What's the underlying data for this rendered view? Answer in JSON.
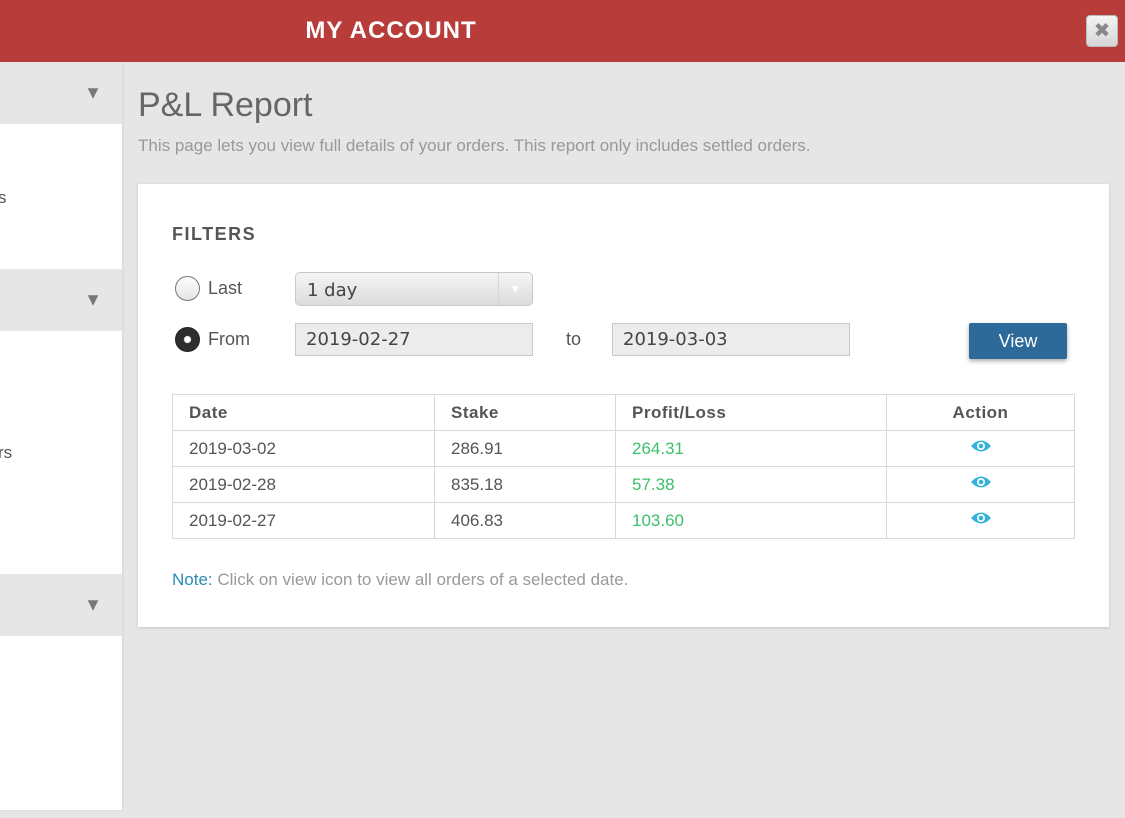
{
  "header": {
    "title": "MY ACCOUNT",
    "close_glyph": "✖"
  },
  "sidebar": {
    "arrow_glyph": "▼",
    "fragments": [
      "s",
      "rs"
    ]
  },
  "main": {
    "title": "P&L Report",
    "description": "This page lets you view full details of your orders. This report only includes settled orders."
  },
  "filters": {
    "heading": "FILTERS",
    "last_label": "Last",
    "last_selected": false,
    "period_value": "1 day",
    "from_label": "From",
    "from_selected": true,
    "from_date": "2019-02-27",
    "to_label": "to",
    "to_date": "2019-03-03",
    "view_button": "View"
  },
  "table": {
    "headers": {
      "date": "Date",
      "stake": "Stake",
      "pl": "Profit/Loss",
      "action": "Action"
    },
    "rows": [
      {
        "date": "2019-03-02",
        "stake": "286.91",
        "pl": "264.31"
      },
      {
        "date": "2019-02-28",
        "stake": "835.18",
        "pl": "57.38"
      },
      {
        "date": "2019-02-27",
        "stake": "406.83",
        "pl": "103.60"
      }
    ],
    "action_icon": "eye-icon"
  },
  "note": {
    "label": "Note:",
    "text": " Click on view icon to view all orders of a selected date."
  },
  "colors": {
    "header_bg": "#b83d3a",
    "profit": "#3cc06a",
    "accent": "#2d6a9a",
    "eye": "#35b3d6",
    "note_label": "#2a8ab5"
  }
}
